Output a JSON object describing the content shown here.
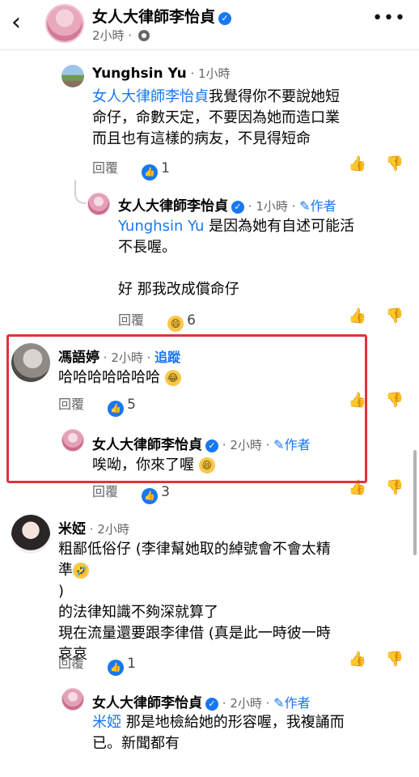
{
  "header": {
    "back_icon": "chevron-left-icon",
    "page_name": "女人大律師李怡貞",
    "time": "2小時",
    "more_icon": "more-dots-icon"
  },
  "comments": [
    {
      "author": "Yunghsin Yu",
      "time": "1小時",
      "mention": "女人大律師李怡貞",
      "lines": [
        "我覺得你不要說她短",
        "命仔，命數天定，不要因為她而造口業",
        "而且也有這樣的病友，不見得短命"
      ],
      "reply_label": "回覆",
      "reaction_count": "1"
    },
    {
      "author": "女人大律師李怡貞",
      "time": "1小時",
      "author_badge": "作者",
      "mention": "Yunghsin Yu",
      "lines": [
        " 是因為她有自述可能活",
        "不長喔。",
        "好 那我改成償命仔"
      ],
      "reply_label": "回覆",
      "reaction_count": "6"
    },
    {
      "author": "馮語婷",
      "time": "2小時",
      "follow_label": "追蹤",
      "lines": [
        "哈哈哈哈哈哈哈"
      ],
      "reply_label": "回覆",
      "reaction_count": "5"
    },
    {
      "author": "女人大律師李怡貞",
      "time": "2小時",
      "author_badge": "作者",
      "lines": [
        "唉呦，你來了喔"
      ],
      "reply_label": "回覆",
      "reaction_count": "3"
    },
    {
      "author": "米婭",
      "time": "2小時",
      "lines": [
        "粗鄙低俗仔 (李律幫她取的綽號會不會太精",
        "準",
        ")",
        "的法律知識不夠深就算了",
        "現在流量還要跟李律借 (真是此一時彼一時",
        "哀哀"
      ],
      "reply_label": "回覆",
      "reaction_count": "1"
    },
    {
      "author": "女人大律師李怡貞",
      "time": "2小時",
      "author_badge": "作者",
      "mention": "米婭",
      "lines": [
        " 那是地檢給她的形容喔，我複誦而",
        "已。新聞都有"
      ]
    }
  ],
  "colors": {
    "accent": "#1877f2",
    "highlight_box": "#e0323f",
    "meta_text": "#65676b"
  }
}
